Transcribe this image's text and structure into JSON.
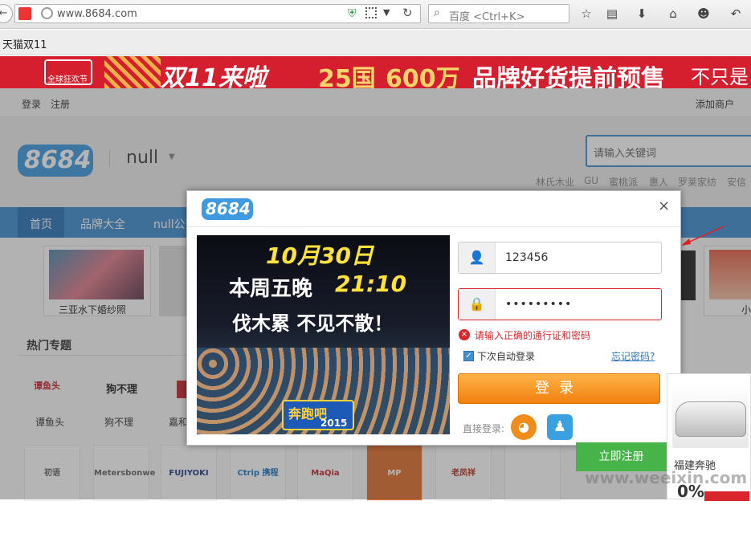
{
  "browser": {
    "url": "www.8684.com",
    "search_placeholder": "百度 <Ctrl+K>",
    "bookmark_1": "天猫双11"
  },
  "banner": {
    "logo_text": "全球狂欢节",
    "slogan_1": "双11来啦",
    "slogan_2": "25国",
    "slogan_3": "600万",
    "slogan_4": "品牌好货提前预售",
    "slogan_5": "不只是"
  },
  "topnav": {
    "login": "登录",
    "register": "注册",
    "add_merchant": "添加商户"
  },
  "header": {
    "logo": "8684",
    "city": "null",
    "search_placeholder": "请输入关键词",
    "hot_words": [
      "林氏木业",
      "GU",
      "蜜桃派",
      "惠人",
      "罗莱家纺",
      "安信"
    ]
  },
  "navbar": {
    "items": [
      "首页",
      "品牌大全",
      "null公交"
    ]
  },
  "content": {
    "thumb_label_1": "三亚水下婚纱照",
    "thumb_label_2": "小",
    "section_title": "热门专题",
    "topics": [
      "谭鱼头",
      "狗不理",
      "嘉和"
    ],
    "brand_logos": [
      "初语",
      "Metersbonwe",
      "FUJIYOKI",
      "Ctrip 携程",
      "MaQia",
      "MP mornings",
      "老凤祥",
      "",
      ""
    ]
  },
  "modal": {
    "logo": "8684",
    "close": "×",
    "poster": {
      "line1": "10月30日",
      "line2a": "本周五晚",
      "line2b": "21:10",
      "line3": "伐木累 不见不散！",
      "show": "奔跑吧",
      "year": "2015"
    },
    "username_value": "123456",
    "password_value": "•••••••••",
    "error_text": "请输入正确的通行证和密码",
    "remember_label": "下次自动登录",
    "forgot_link": "忘记密码?",
    "login_button": "登录",
    "direct_login_label": "直接登录:"
  },
  "side_ad": {
    "car_label": "福建奔驰",
    "register_button": "立即注册",
    "rate": "0%",
    "watermark": "www.weeixin.com"
  },
  "colors": {
    "accent_blue": "#3f8fd2",
    "login_orange": "#f5920f",
    "error_red": "#d9262c",
    "banner_red": "#d51e2e",
    "register_green": "#46b449"
  },
  "icons": [
    "back-icon",
    "shield-icon",
    "qr-icon",
    "reload-icon",
    "search-icon",
    "star-icon",
    "reader-icon",
    "download-icon",
    "home-icon",
    "chat-icon",
    "undo-icon",
    "user-icon",
    "lock-icon",
    "error-icon",
    "checkbox-icon",
    "weibo-icon",
    "qq-icon",
    "close-icon",
    "dropdown-icon"
  ]
}
